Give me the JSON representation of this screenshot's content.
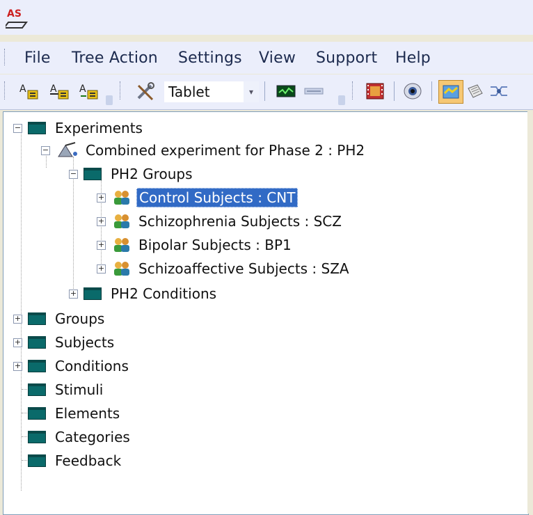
{
  "menu": {
    "file": "File",
    "tree_action": "Tree Action",
    "settings": "Settings",
    "view": "View",
    "support": "Support",
    "help": "Help"
  },
  "toolbar": {
    "device_combo": "Tablet"
  },
  "tree": {
    "experiments": "Experiments",
    "combined_experiment": "Combined experiment for Phase 2 : PH2",
    "ph2_groups": "PH2 Groups",
    "control_subjects": "Control Subjects : CNT",
    "schizophrenia_subjects": "Schizophrenia Subjects : SCZ",
    "bipolar_subjects": "Bipolar Subjects : BP1",
    "schizoaffective_subjects": "Schizoaffective Subjects : SZA",
    "ph2_conditions": "PH2 Conditions",
    "groups": "Groups",
    "subjects": "Subjects",
    "conditions": "Conditions",
    "stimuli": "Stimuli",
    "elements": "Elements",
    "categories": "Categories",
    "feedback": "Feedback"
  },
  "colors": {
    "selection": "#316ac5",
    "folder": "#0a6a6a",
    "bar_bg": "#ebeefb"
  }
}
